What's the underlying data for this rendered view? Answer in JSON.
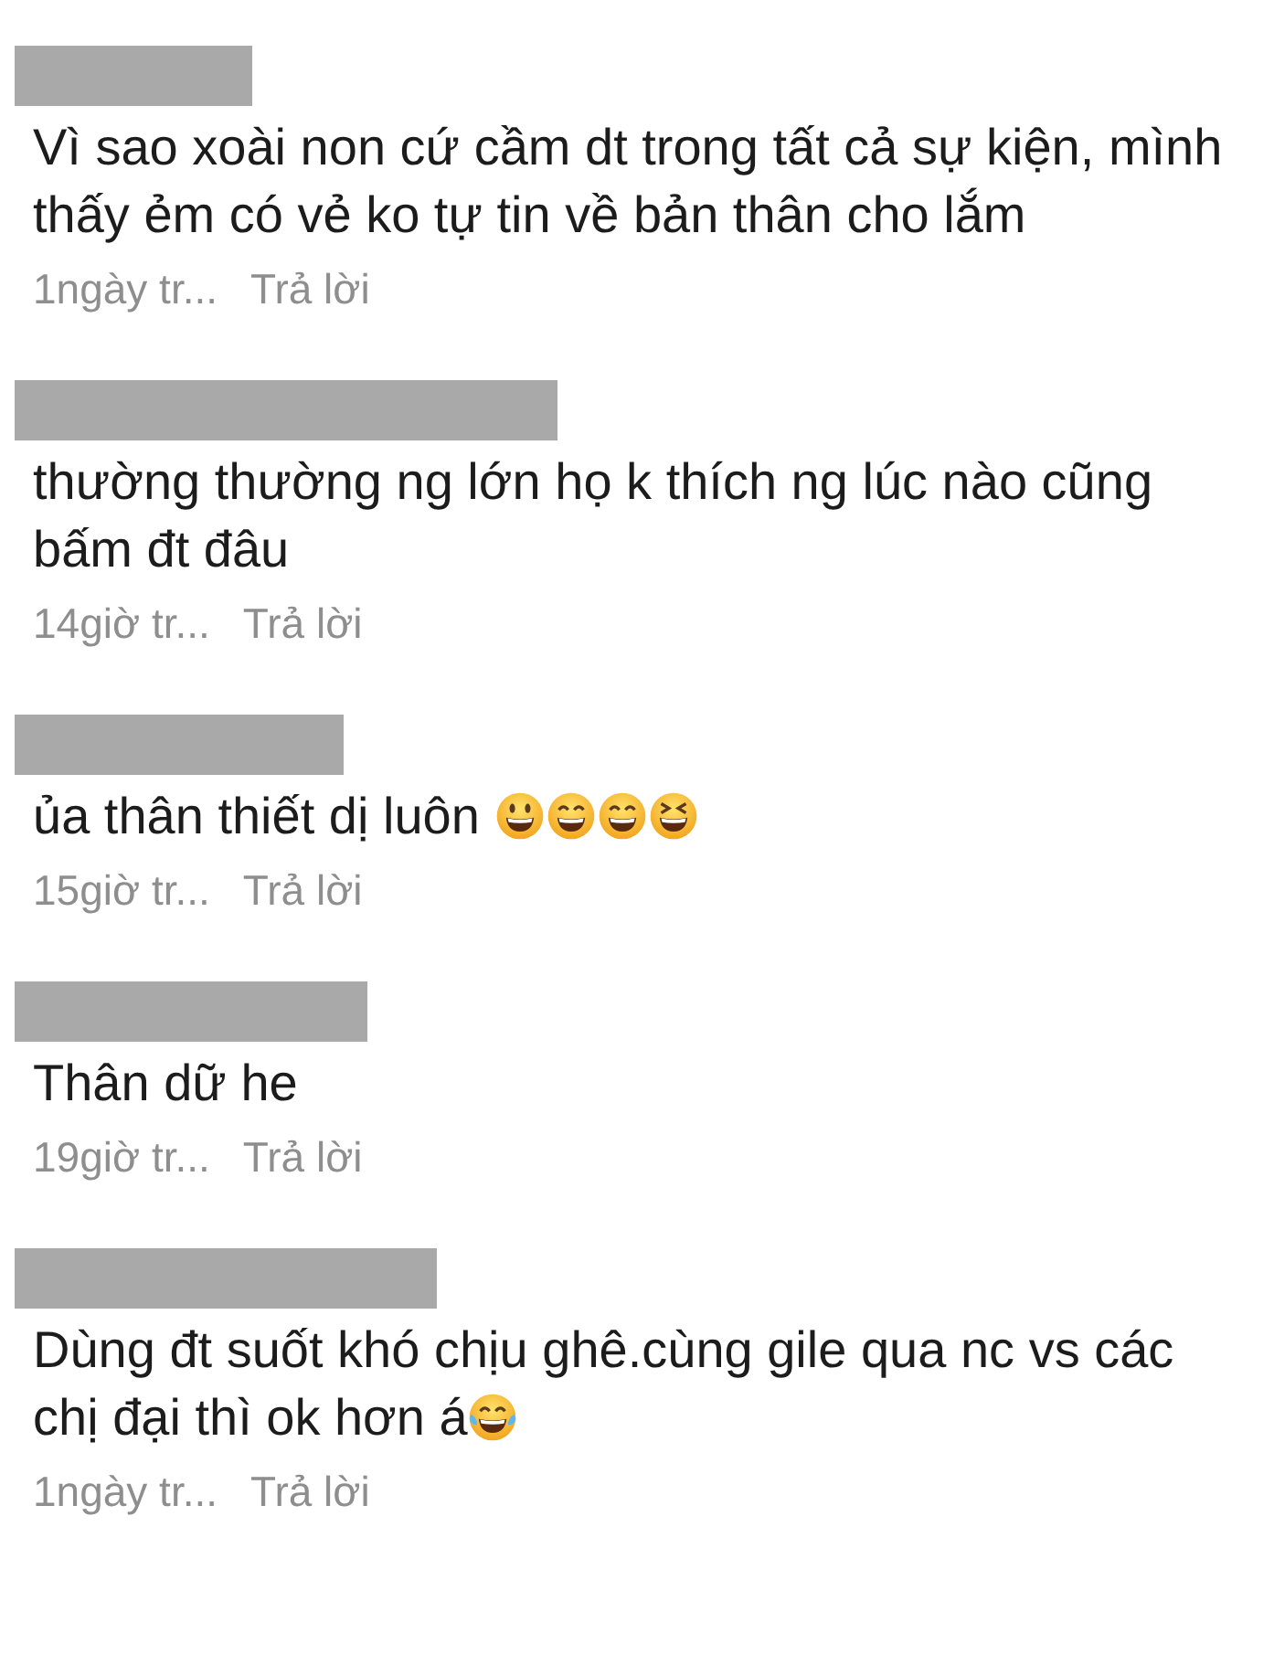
{
  "comments": [
    {
      "lines": [
        "Vì sao xoài non cứ cầm dt trong tất cả sự kiện, mình",
        "thấy ẻm có vẻ ko tự tin về bản thân cho lắm"
      ],
      "time": "1ngày tr...",
      "reply": "Trả lời"
    },
    {
      "lines": [
        "thường thường ng lớn họ k thích ng lúc nào cũng",
        "bấm đt đâu"
      ],
      "time": "14giờ tr...",
      "reply": "Trả lời"
    },
    {
      "lines": [
        "ủa thân thiết dị luôn"
      ],
      "emojis": [
        {
          "kind": "smiley"
        },
        {
          "kind": "grin"
        },
        {
          "kind": "grin"
        },
        {
          "kind": "squint"
        }
      ],
      "time": "15giờ tr...",
      "reply": "Trả lời"
    },
    {
      "lines": [
        "Thân dữ he"
      ],
      "time": "19giờ tr...",
      "reply": "Trả lời"
    },
    {
      "lines": [
        "Dùng đt suốt khó chịu ghê.cùng gile qua nc vs các",
        "chị đại thì ok hơn á"
      ],
      "emojis": [
        {
          "kind": "tears-of-joy"
        }
      ],
      "time": "1ngày tr...",
      "reply": "Trả lời"
    }
  ]
}
